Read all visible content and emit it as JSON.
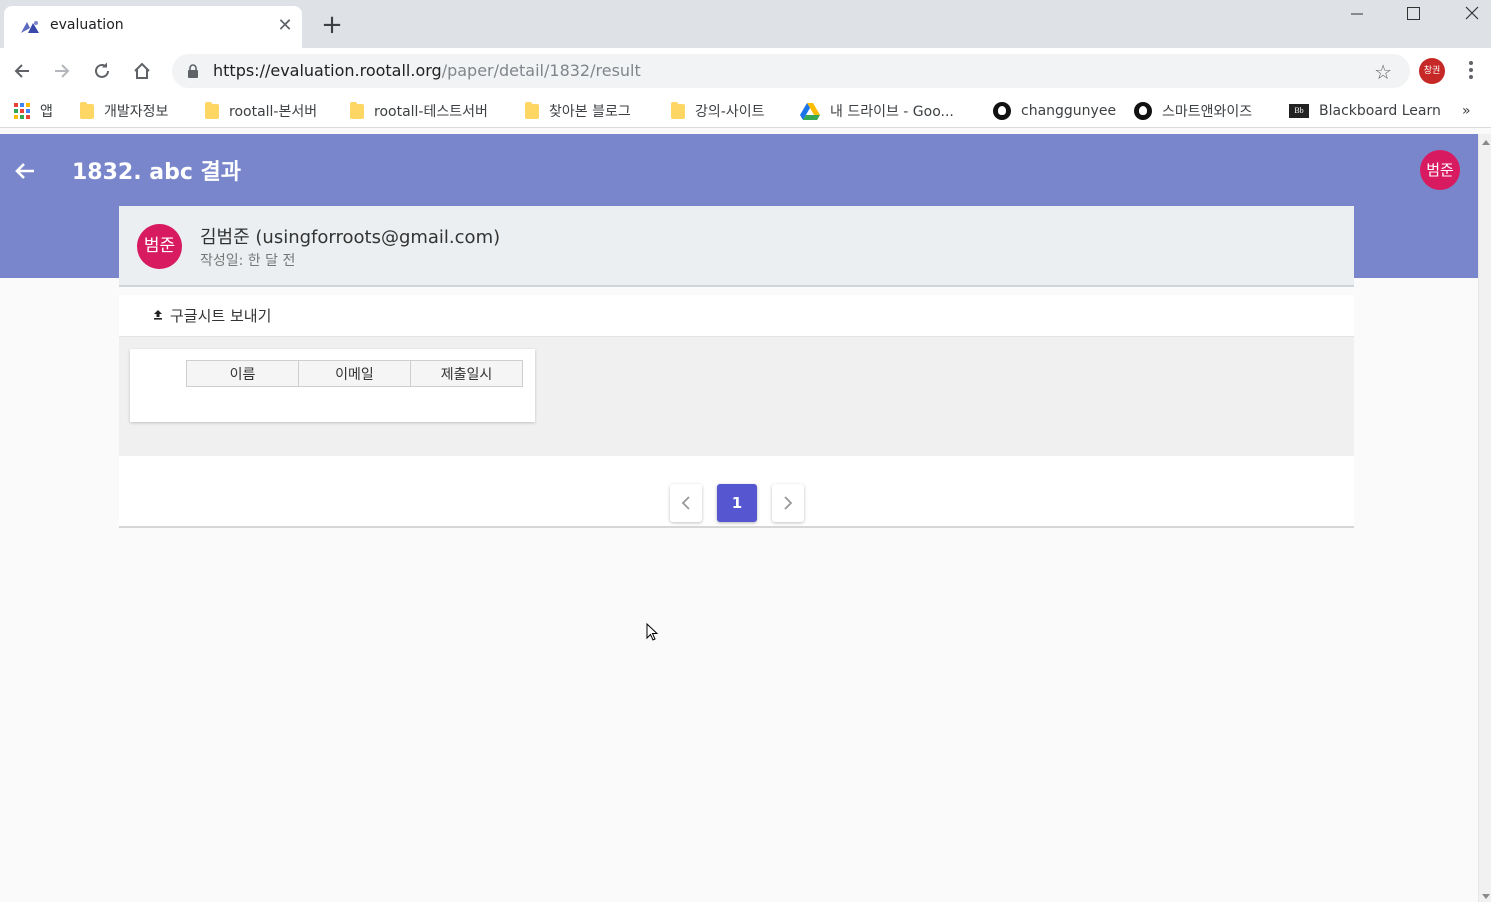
{
  "browser": {
    "tab_title": "evaluation",
    "new_tab_symbol": "+",
    "url_host": "https://evaluation.rootall.org",
    "url_path": "/paper/detail/1832/result",
    "profile_initials": "창권",
    "bookmarks": {
      "apps": "앱",
      "items": [
        {
          "label": "개발자정보",
          "icon": "folder-icon"
        },
        {
          "label": "rootall-본서버",
          "icon": "folder-icon"
        },
        {
          "label": "rootall-테스트서버",
          "icon": "folder-icon"
        },
        {
          "label": "찾아본 블로그",
          "icon": "folder-icon"
        },
        {
          "label": "강의-사이트",
          "icon": "folder-icon"
        },
        {
          "label": "내 드라이브 - Goo...",
          "icon": "google-drive-icon"
        },
        {
          "label": "changgunyee",
          "icon": "github-icon"
        },
        {
          "label": "스마트앤와이즈",
          "icon": "github-icon"
        },
        {
          "label": "Blackboard Learn",
          "icon": "blackboard-icon"
        }
      ],
      "overflow": "»"
    }
  },
  "appbar": {
    "title": "1832. abc 결과",
    "user_initials": "범준",
    "color": "#7986cb"
  },
  "author": {
    "avatar_initials": "범준",
    "name": "김범준 (usingforroots@gmail.com)",
    "created": "작성일: 한 달 전",
    "avatar_color": "#d81b60"
  },
  "export": {
    "label": "구글시트 보내기",
    "icon": "upload-icon"
  },
  "table": {
    "columns": [
      "이름",
      "이메일",
      "제출일시"
    ]
  },
  "pagination": {
    "current_page": "1",
    "accent": "#5656d0"
  }
}
